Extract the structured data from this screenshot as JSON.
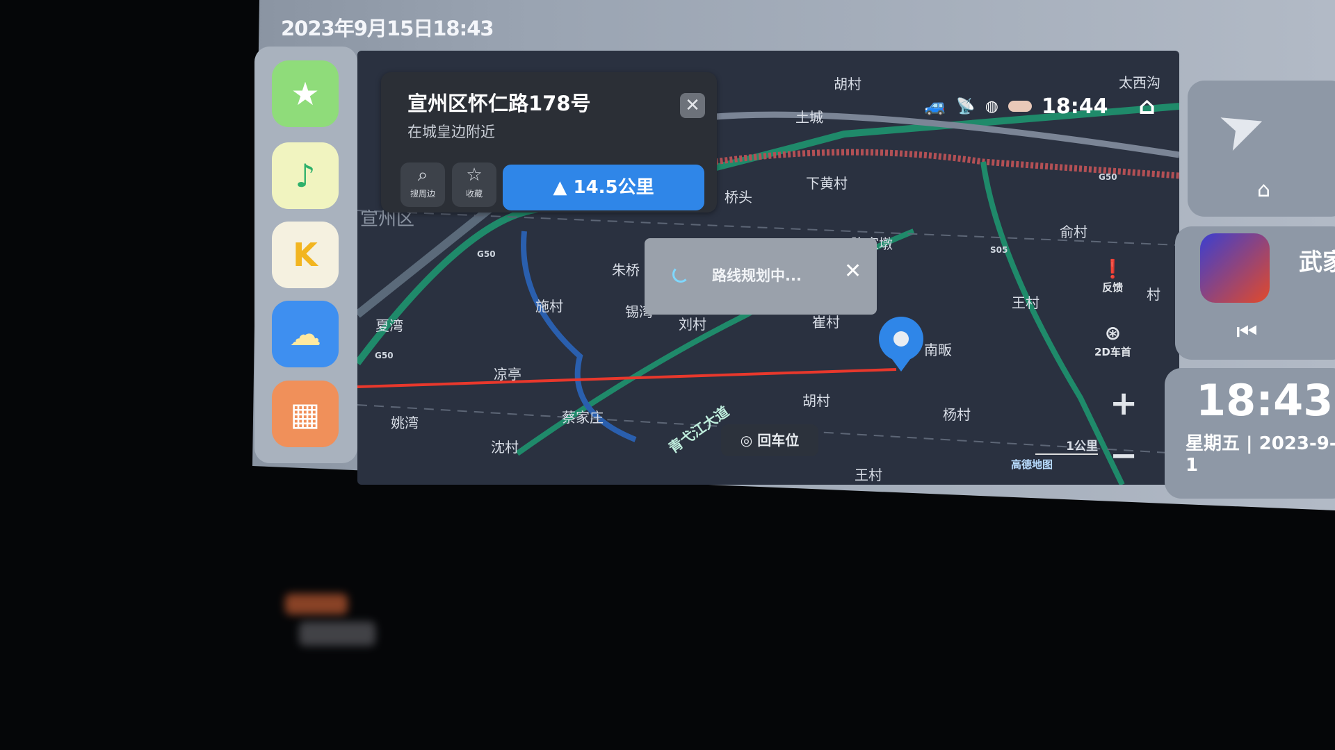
{
  "header": {
    "datetime": "2023年9月15日18:43"
  },
  "dock": {
    "apps": [
      {
        "name": "favorites",
        "icon": "star-icon",
        "color": "#8fdc7a"
      },
      {
        "name": "music",
        "icon": "music-note-icon",
        "color": "#f1f4c0"
      },
      {
        "name": "karaoke",
        "icon": "k-song-icon",
        "color": "#f5f1e0"
      },
      {
        "name": "kids",
        "icon": "cartoon-icon",
        "color": "#3e8ff0"
      },
      {
        "name": "apps",
        "icon": "grid-icon",
        "color": "#f0905a"
      }
    ]
  },
  "map": {
    "labels": [
      "胡村",
      "土城",
      "太西沟",
      "下黄村",
      "桥头",
      "俞村",
      "宣州区",
      "朱桥",
      "陈家墩",
      "施村",
      "锡湾",
      "刘村",
      "崔村",
      "王村",
      "夏湾",
      "凉亭",
      "胡村",
      "杨村",
      "姚湾",
      "蔡家庄",
      "沈村",
      "王村",
      "青弋江大道",
      "南畈",
      "村"
    ],
    "road_codes": [
      "G50",
      "G50",
      "G50",
      "S05"
    ],
    "status_time": "18:44",
    "scale": "1公里",
    "brand": "高德地图",
    "feedback": "反馈",
    "view_mode": "2D车首",
    "recenter": "回车位",
    "zoom_in": "+",
    "zoom_out": "−",
    "route_color": "#e8382c",
    "pin_color": "#2f86e8"
  },
  "poi_card": {
    "title": "宣州区怀仁路178号",
    "subtitle": "在城皇边附近",
    "close": "✕",
    "search_nearby": "搜周边",
    "favorite": "收藏",
    "navigate": "14.5公里"
  },
  "toast": {
    "text": "路线规划中...",
    "close": "✕"
  },
  "right": {
    "music_title": "武家",
    "clock_time": "18:43",
    "clock_date": "星期五 | 2023-9-1"
  }
}
